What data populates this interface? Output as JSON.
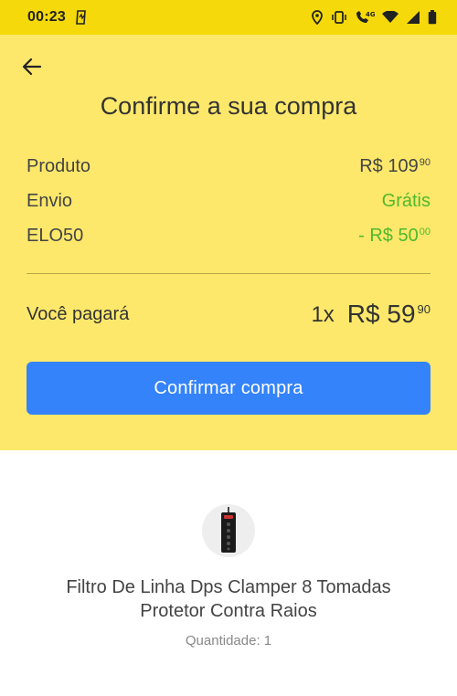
{
  "status_bar": {
    "time": "00:23",
    "network": "4G"
  },
  "header": {
    "title": "Confirme a sua compra"
  },
  "summary": {
    "product": {
      "label": "Produto",
      "currency": "R$",
      "amount": "109",
      "cents": "90"
    },
    "shipping": {
      "label": "Envio",
      "value": "Grátis"
    },
    "coupon": {
      "label": "ELO50",
      "prefix": "- R$",
      "amount": "50",
      "cents": "00"
    }
  },
  "total": {
    "label": "Você pagará",
    "installments": "1x",
    "currency": "R$",
    "amount": "59",
    "cents": "90"
  },
  "confirm_button": {
    "label": "Confirmar compra"
  },
  "item": {
    "title": "Filtro De Linha Dps Clamper 8 Tomadas Protetor Contra Raios",
    "quantity_label": "Quantidade: 1"
  },
  "colors": {
    "status_bar": "#f5d90a",
    "panel": "#fde86b",
    "primary": "#3483fa",
    "discount": "#4fb92c"
  }
}
